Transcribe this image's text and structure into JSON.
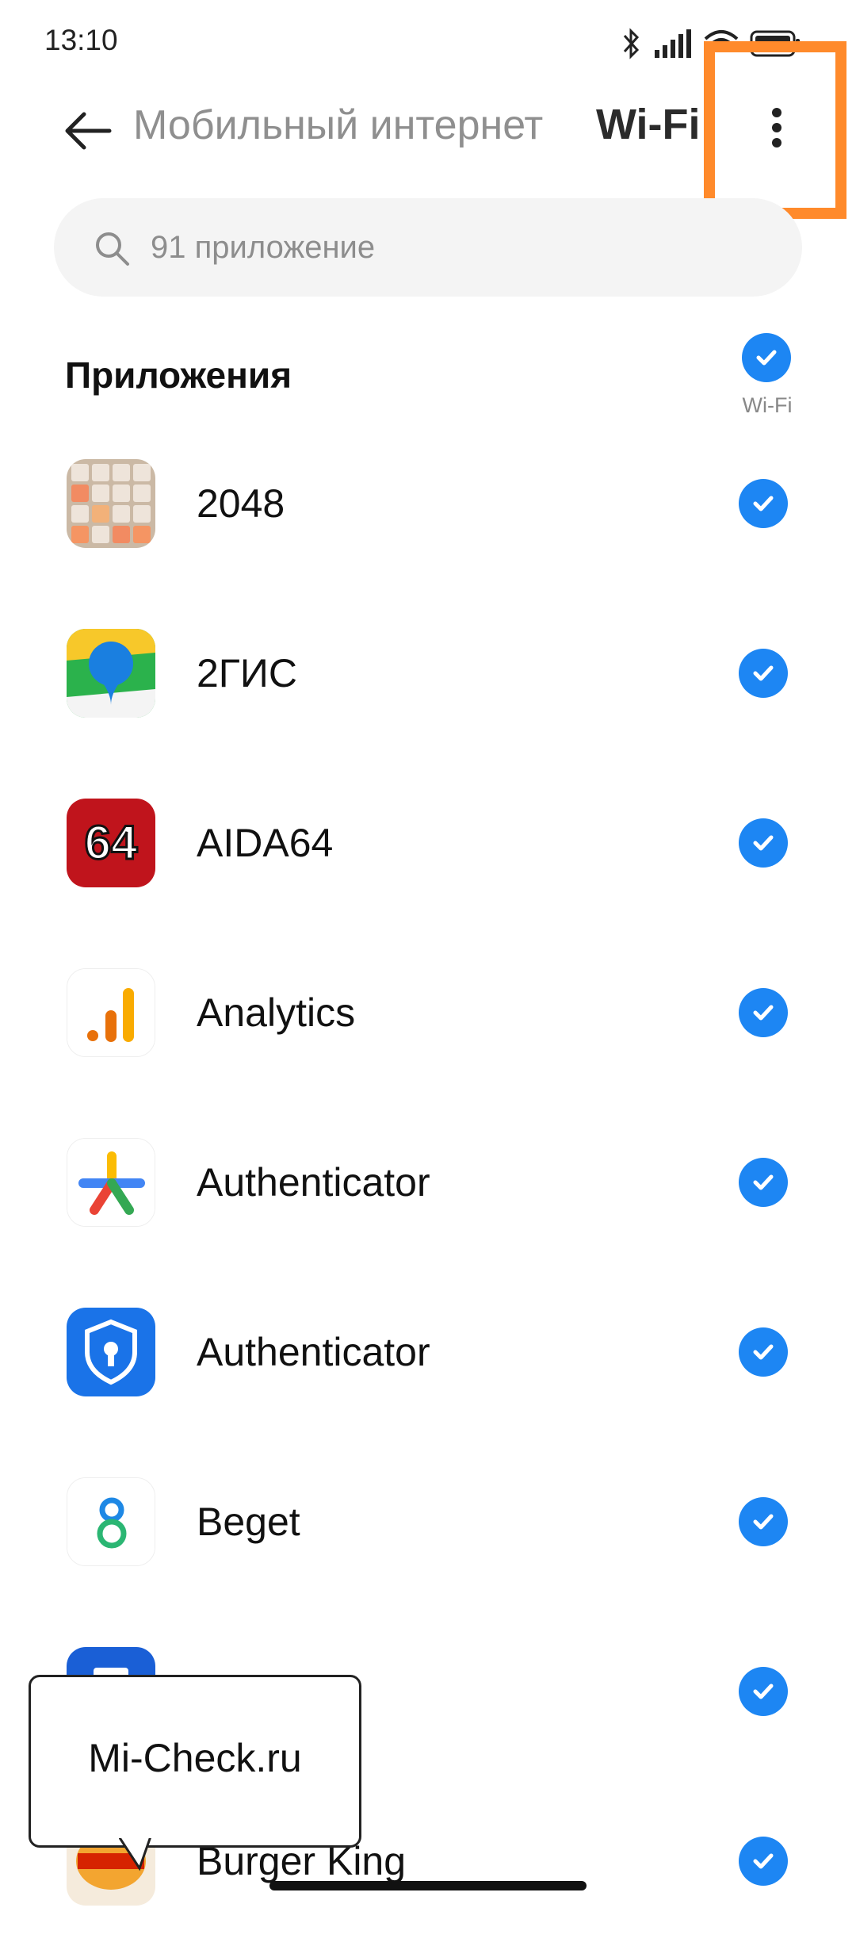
{
  "status_bar": {
    "time": "13:10"
  },
  "header": {
    "tab_mobile": "Мобильный интернет",
    "tab_wifi": "Wi-Fi"
  },
  "search": {
    "placeholder": "91 приложение"
  },
  "section": {
    "title": "Приложения",
    "column_label": "Wi-Fi"
  },
  "apps": [
    {
      "name": "2048",
      "icon": "2048-game-icon",
      "wifi_enabled": true
    },
    {
      "name": "2ГИС",
      "icon": "2gis-map-icon",
      "wifi_enabled": true
    },
    {
      "name": "AIDA64",
      "icon": "aida64-icon",
      "wifi_enabled": true
    },
    {
      "name": "Analytics",
      "icon": "analytics-bars-icon",
      "wifi_enabled": true
    },
    {
      "name": "Authenticator",
      "icon": "google-authenticator-icon",
      "wifi_enabled": true
    },
    {
      "name": "Authenticator",
      "icon": "microsoft-authenticator-shield-icon",
      "wifi_enabled": true
    },
    {
      "name": "Beget",
      "icon": "beget-icon",
      "wifi_enabled": true
    },
    {
      "name": "",
      "icon": "blue-app-icon",
      "wifi_enabled": true
    },
    {
      "name": "Burger King",
      "icon": "burger-king-icon",
      "wifi_enabled": true
    }
  ],
  "watermark": {
    "text": "Mi-Check.ru"
  },
  "colors": {
    "accent": "#1d86f3",
    "highlight": "#ff8a2b"
  }
}
